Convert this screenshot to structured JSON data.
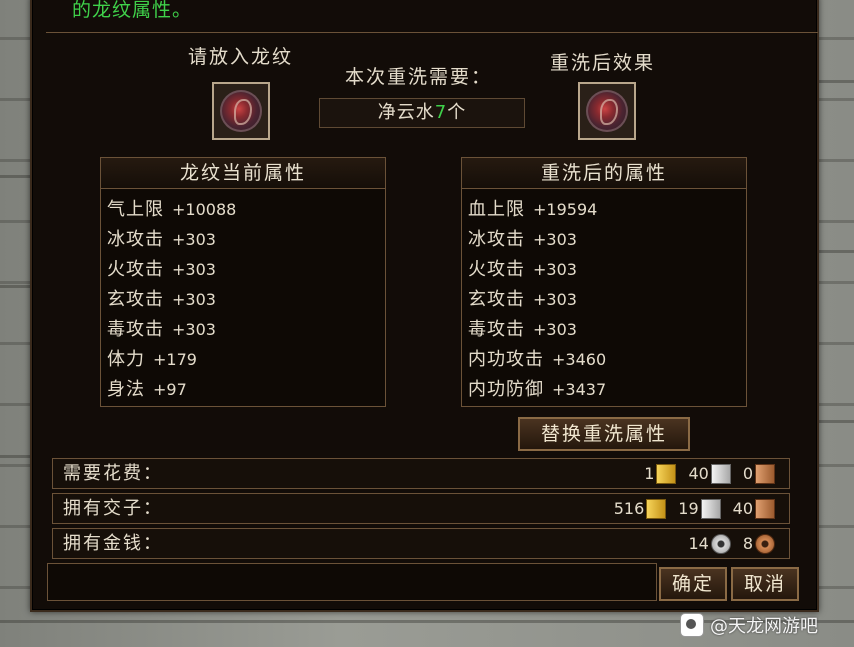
{
  "top_message": "的龙纹属性。",
  "slot_input_label": "请放入龙纹",
  "cost_heading": "本次重洗需要：",
  "cost_item": {
    "prefix": "净云水",
    "count": "7",
    "suffix": "个"
  },
  "slot_result_label": "重洗后效果",
  "current_panel": {
    "title": "龙纹当前属性",
    "attrs": [
      {
        "name": "气上限",
        "value": "+10088"
      },
      {
        "name": "冰攻击",
        "value": "+303"
      },
      {
        "name": "火攻击",
        "value": "+303"
      },
      {
        "name": "玄攻击",
        "value": "+303"
      },
      {
        "name": "毒攻击",
        "value": "+303"
      },
      {
        "name": "体力",
        "value": "+179"
      },
      {
        "name": "身法",
        "value": "+97"
      }
    ]
  },
  "result_panel": {
    "title": "重洗后的属性",
    "attrs": [
      {
        "name": "血上限",
        "value": "+19594"
      },
      {
        "name": "冰攻击",
        "value": "+303"
      },
      {
        "name": "火攻击",
        "value": "+303"
      },
      {
        "name": "玄攻击",
        "value": "+303"
      },
      {
        "name": "毒攻击",
        "value": "+303"
      },
      {
        "name": "内功攻击",
        "value": "+3460"
      },
      {
        "name": "内功防御",
        "value": "+3437"
      }
    ]
  },
  "replace_button": "替换重洗属性",
  "cost_row": {
    "label": "需要花费：",
    "gold": "1",
    "silver": "40",
    "copper": "0"
  },
  "jiaozi_row": {
    "label": "拥有交子：",
    "gold": "516",
    "silver": "19",
    "copper": "40"
  },
  "money_row": {
    "label": "拥有金钱：",
    "silver": "14",
    "copper": "8"
  },
  "confirm_button": "确定",
  "cancel_button": "取消",
  "watermark": "@天龙网游吧",
  "icons": {
    "gold": "gold-note-icon",
    "silver": "silver-note-icon",
    "copper": "copper-note-icon",
    "silver_coin": "silver-coin-icon",
    "copper_coin": "copper-coin-icon"
  },
  "colors": {
    "highlight_green": "#3fd14a",
    "text": "#e4dccb",
    "border": "#6b5238",
    "panel_bg": "#120c08"
  }
}
